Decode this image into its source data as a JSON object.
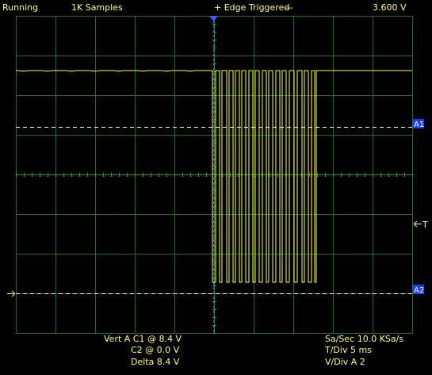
{
  "status": {
    "run_state": "Running",
    "samples": "1K Samples",
    "trigger": "+ Edge Triggered",
    "trigger_dash": "—",
    "trigger_level": "3.600  V"
  },
  "markers": {
    "a1": "A1",
    "a2": "A2",
    "trigger": "T"
  },
  "readout": {
    "vert_a_c1": "Vert A  C1 @ 8.4  V",
    "c2": "C2 @ 0.0  V",
    "delta": "Delta 8.4  V",
    "sa_sec": "Sa/Sec  10.0 KSa/s",
    "t_div": "T/Div     5 ms",
    "v_div": "V/Div  A 2"
  },
  "colors": {
    "background": "#000000",
    "grid": "#1e6e1e",
    "trace": "#ffff33",
    "text": "#ffff66",
    "cursor_marker": "#3a5cff",
    "cursor_line": "#ffffff"
  }
}
